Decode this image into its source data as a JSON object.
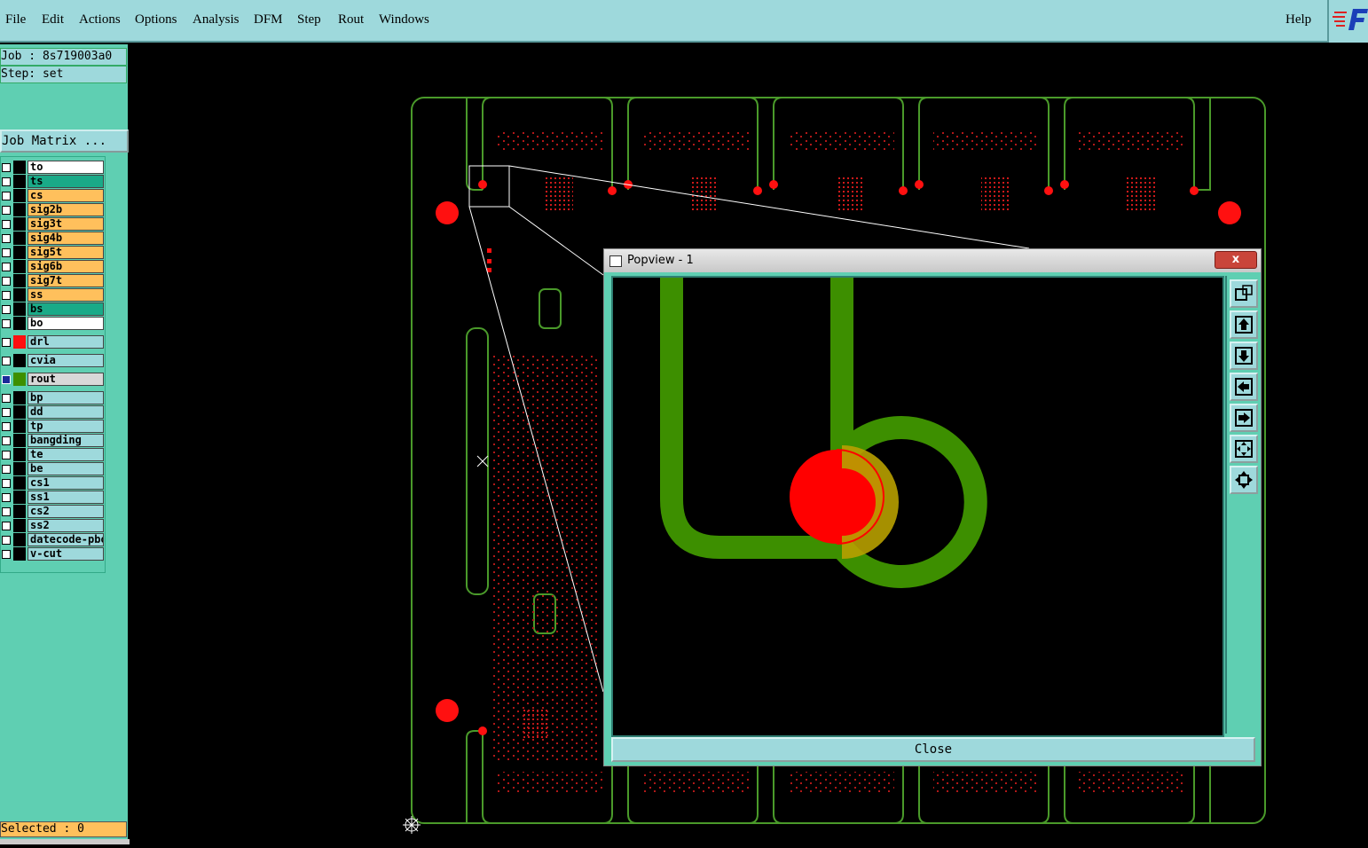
{
  "menubar": {
    "items": [
      "File",
      "Edit",
      "Actions",
      "Options",
      "Analysis",
      "DFM",
      "Step",
      "Rout",
      "Windows"
    ],
    "help": "Help"
  },
  "job": {
    "job_label": "Job : 8s719003a0",
    "step_label": "Step: set",
    "matrix_button": "Job Matrix ..."
  },
  "layers": [
    {
      "name": "to",
      "color": "#ffffff"
    },
    {
      "name": "ts",
      "color": "#1aaa88"
    },
    {
      "name": "cs",
      "color": "#ffc05c"
    },
    {
      "name": "sig2b",
      "color": "#ffc05c"
    },
    {
      "name": "sig3t",
      "color": "#ffc05c"
    },
    {
      "name": "sig4b",
      "color": "#ffc05c"
    },
    {
      "name": "sig5t",
      "color": "#ffc05c"
    },
    {
      "name": "sig6b",
      "color": "#ffc05c"
    },
    {
      "name": "sig7t",
      "color": "#ffc05c"
    },
    {
      "name": "ss",
      "color": "#ffc05c"
    },
    {
      "name": "bs",
      "color": "#1aaa88"
    },
    {
      "name": "bo",
      "color": "#ffffff"
    },
    {
      "name": "drl",
      "color": "#9ed9dc"
    },
    {
      "name": "cvia",
      "color": "#9ed9dc"
    },
    {
      "name": "rout",
      "color": "#d8d8d8"
    },
    {
      "name": "bp",
      "color": "#9ed9dc"
    },
    {
      "name": "dd",
      "color": "#9ed9dc"
    },
    {
      "name": "tp",
      "color": "#9ed9dc"
    },
    {
      "name": "bangding",
      "color": "#9ed9dc"
    },
    {
      "name": "te",
      "color": "#9ed9dc"
    },
    {
      "name": "be",
      "color": "#9ed9dc"
    },
    {
      "name": "cs1",
      "color": "#9ed9dc"
    },
    {
      "name": "ss1",
      "color": "#9ed9dc"
    },
    {
      "name": "cs2",
      "color": "#9ed9dc"
    },
    {
      "name": "ss2",
      "color": "#9ed9dc"
    },
    {
      "name": "datecode-pbo",
      "color": "#9ed9dc"
    },
    {
      "name": "v-cut",
      "color": "#9ed9dc"
    }
  ],
  "status": {
    "selected": "Selected : 0"
  },
  "popview": {
    "title": "Popview - 1",
    "close_x": "x",
    "close_button": "Close"
  },
  "colors": {
    "trace_green": "#3d8f00",
    "outline_green": "#4a9a2a",
    "drill_red": "#ff0000",
    "overlap_gold": "#b8a000"
  }
}
